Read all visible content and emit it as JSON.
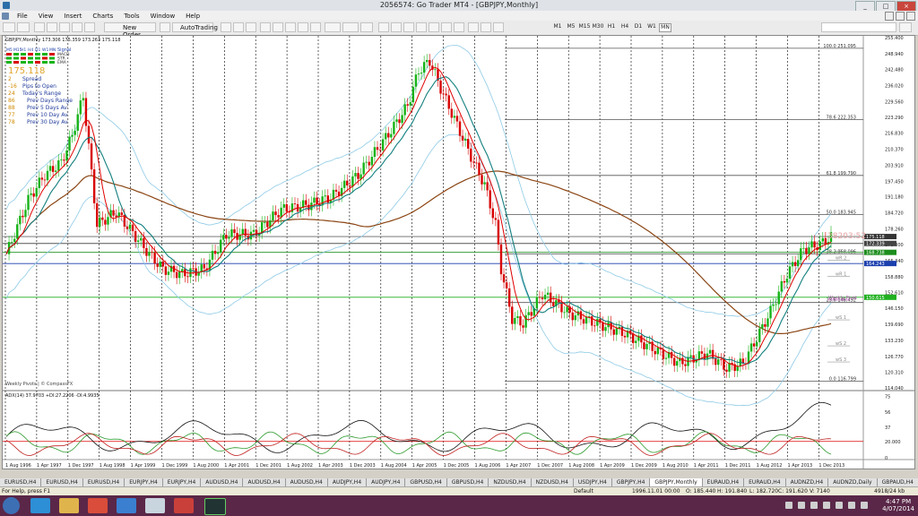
{
  "window": {
    "title": "2056574: Go Trader MT4 - [GBPJPY,Monthly]",
    "buttons": [
      "_",
      "□",
      "×"
    ]
  },
  "menu": [
    "File",
    "View",
    "Insert",
    "Charts",
    "Tools",
    "Window",
    "Help"
  ],
  "toolbar": {
    "new_order": "New Order",
    "autotrading": "AutoTrading",
    "timeframes": [
      "M1",
      "M5",
      "M15",
      "M30",
      "H1",
      "H4",
      "D1",
      "W1",
      "MN"
    ],
    "active_timeframe": "MN"
  },
  "chart": {
    "header": "GBPJPY,Monthly  173.306 175.359 173.263 175.118",
    "signal_tf": [
      "M5",
      "M15",
      "H1",
      "H4",
      "D1",
      "W1",
      "MN"
    ],
    "signal_title": "Signal",
    "signal_rows": [
      "MACD",
      "STR",
      "EMA"
    ],
    "big_price": "175.118",
    "info_rows": [
      {
        "num": "2",
        "label": "Spread"
      },
      {
        "num": "-16",
        "label": "Pips to Open"
      },
      {
        "num": "24",
        "label": "Today's Range"
      },
      {
        "num": "86",
        "label": "Prev Days Range"
      },
      {
        "num": "88",
        "label": "Prev 5 Days Av"
      },
      {
        "num": "77",
        "label": "Prev 10 Day Av"
      },
      {
        "num": "78",
        "label": "Prev 30 Day Av"
      }
    ],
    "countdown": "38203:52",
    "watermark": "Weekly Pivots | © CompassFX",
    "price_axis": [
      "255.400",
      "248.940",
      "242.480",
      "236.020",
      "229.560",
      "223.290",
      "216.830",
      "210.370",
      "203.910",
      "197.450",
      "191.180",
      "184.720",
      "178.260",
      "171.800",
      "165.340",
      "158.880",
      "152.610",
      "146.150",
      "139.690",
      "133.230",
      "126.770",
      "120.310",
      "114.040"
    ],
    "price_tags": {
      "current": "175.118",
      "line2": "172.339",
      "line3": "168.738",
      "blue": "164.243",
      "green": "150.615"
    },
    "fib_levels": [
      {
        "label": "100.0  251.095",
        "price": 251.095
      },
      {
        "label": "78.6  222.353",
        "price": 222.353
      },
      {
        "label": "61.8  199.790",
        "price": 199.79
      },
      {
        "label": "50.0  183.945",
        "price": 183.945
      },
      {
        "label": "38.2  168.096",
        "price": 168.096
      },
      {
        "label": "23.6  148.492",
        "price": 148.492
      },
      {
        "label": "0.0  116.799",
        "price": 116.799
      }
    ],
    "pivot_labels": [
      "wR 3",
      "wR 2",
      "wR 1",
      "Weekly Pivot",
      "wS 1",
      "wS 2",
      "wS 3"
    ],
    "date_axis": [
      "1 Aug 1996",
      "1 Apr 1997",
      "1 Dec 1997",
      "1 Aug 1998",
      "1 Apr 1999",
      "1 Dec 1999",
      "1 Aug 2000",
      "1 Apr 2001",
      "1 Dec 2001",
      "1 Aug 2002",
      "1 Apr 2003",
      "1 Dec 2003",
      "1 Aug 2004",
      "1 Apr 2005",
      "1 Dec 2005",
      "1 Aug 2006",
      "1 Apr 2007",
      "1 Dec 2007",
      "1 Aug 2008",
      "1 Apr 2009",
      "1 Dec 2009",
      "1 Aug 2010",
      "1 Apr 2011",
      "1 Dec 2011",
      "1 Aug 2012",
      "1 Apr 2013",
      "1 Dec 2013"
    ],
    "adx_header": "ADX(14) 37.9703 +DI:27.2206 -DI:4.9935",
    "adx_axis": [
      "75",
      "56",
      "37",
      "20.000",
      "0"
    ],
    "colors": {
      "bull": "#16b316",
      "bear": "#d80000",
      "ema_red": "#e00000",
      "ema_teal": "#137f7f",
      "ma_brown": "#8b4513",
      "band": "#8ecae6",
      "fib": "#555555"
    }
  },
  "tabs": [
    "EURUSD,H4",
    "EURUSD,H4",
    "EURUSD,H4",
    "EURJPY,H4",
    "EURJPY,H4",
    "AUDUSD,H4",
    "AUDUSD,H4",
    "AUDUSD,H4",
    "AUDJPY,H4",
    "AUDJPY,H4",
    "GBPUSD,H4",
    "GBPUSD,H4",
    "NZDUSD,H4",
    "NZDUSD,H4",
    "USDJPY,H4",
    "GBPJPY,H4",
    "GBPJPY,Monthly",
    "EURAUD,H4",
    "EURAUD,H4",
    "AUDNZD,H4",
    "AUDNZD,Daily",
    "GBPAUD,H4",
    "GBPA"
  ],
  "active_tab": "GBPJPY,Monthly",
  "status": {
    "help": "For Help, press F1",
    "profile": "Default",
    "date": "1996.11.01 00:00",
    "o": "O: 185.440",
    "h": "H: 191.840",
    "l": "L: 182.720",
    "c": "C: 191.620",
    "v": "V: 7140",
    "kb": "4918/24 kb"
  },
  "clock": {
    "time": "4:47 PM",
    "date": "4/07/2014"
  }
}
